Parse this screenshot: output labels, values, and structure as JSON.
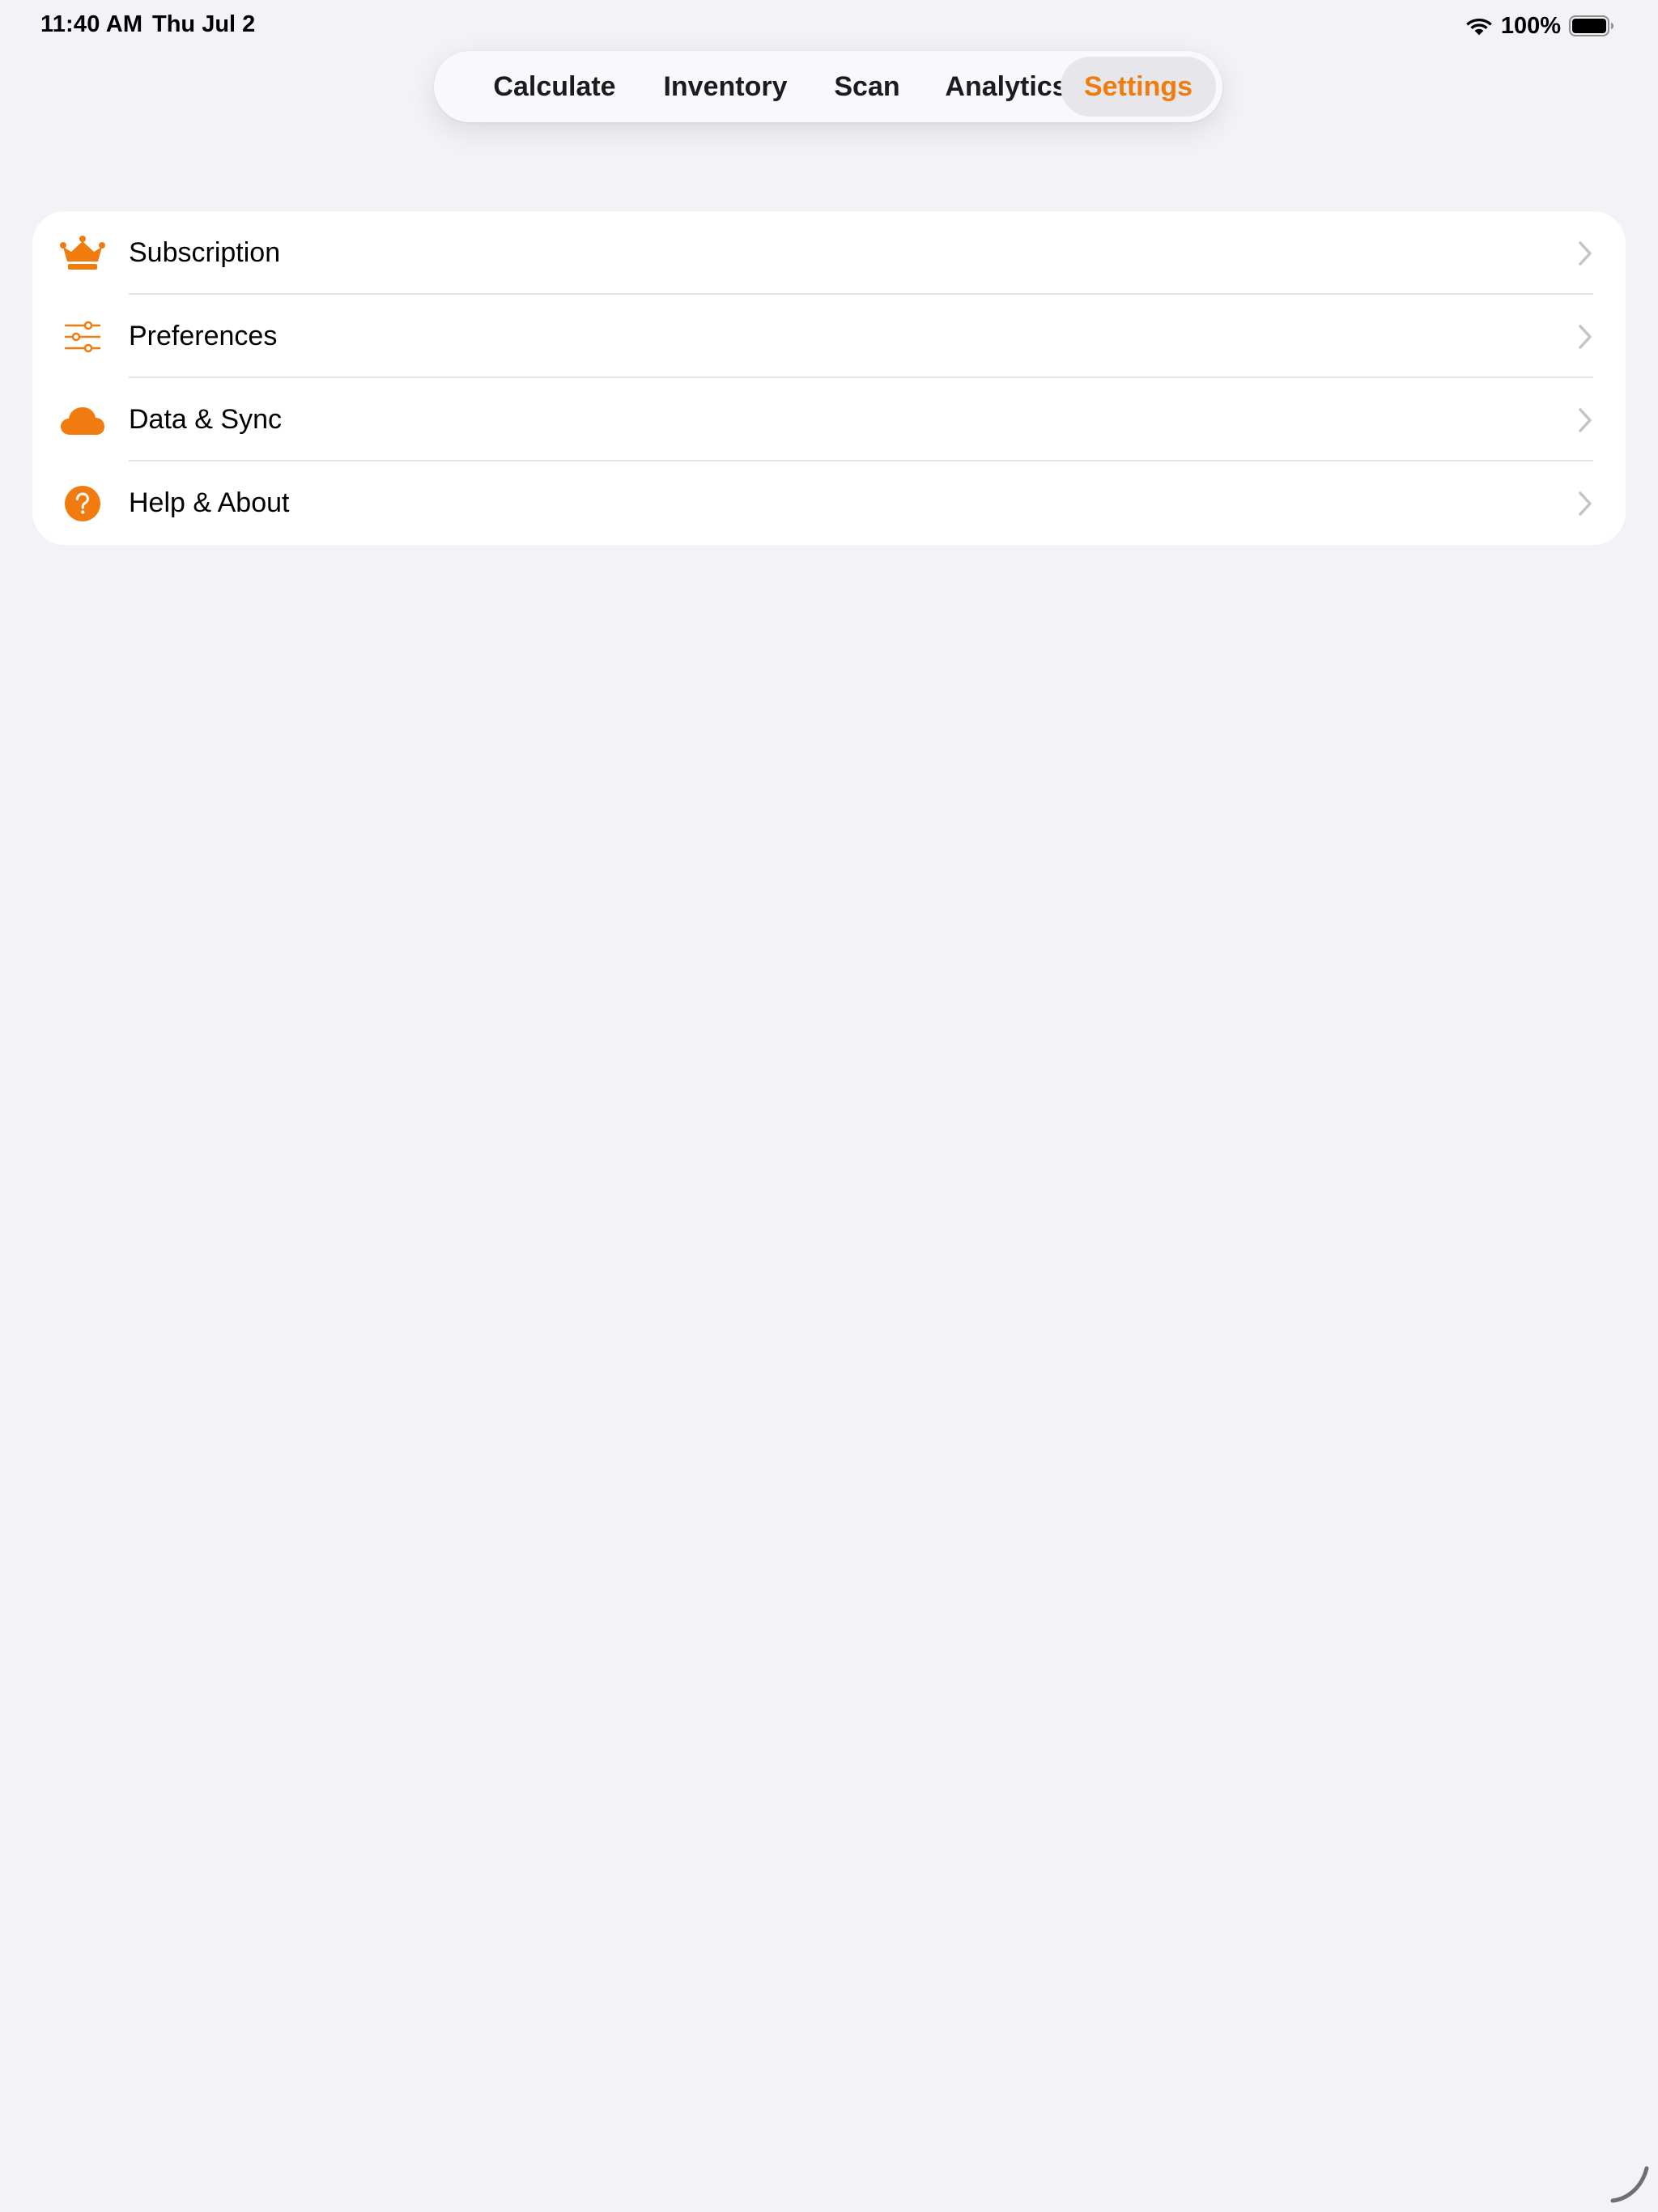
{
  "status_bar": {
    "time": "11:40 AM",
    "date": "Thu Jul 2",
    "battery_percent": "100%",
    "battery_level": 1.0,
    "wifi_icon": "wifi-icon",
    "battery_icon": "battery-icon"
  },
  "tabs": [
    {
      "label": "Calculate",
      "active": false
    },
    {
      "label": "Inventory",
      "active": false
    },
    {
      "label": "Scan",
      "active": false
    },
    {
      "label": "Analytics",
      "active": false
    },
    {
      "label": "Settings",
      "active": true
    }
  ],
  "settings": {
    "items": [
      {
        "label": "Subscription",
        "icon": "crown-icon"
      },
      {
        "label": "Preferences",
        "icon": "sliders-icon"
      },
      {
        "label": "Data & Sync",
        "icon": "cloud-icon"
      },
      {
        "label": "Help & About",
        "icon": "question-circle-icon"
      }
    ]
  },
  "colors": {
    "accent": "#f07c0f",
    "background": "#f2f2f7",
    "card": "#ffffff",
    "chevron": "#c4c4c7"
  }
}
